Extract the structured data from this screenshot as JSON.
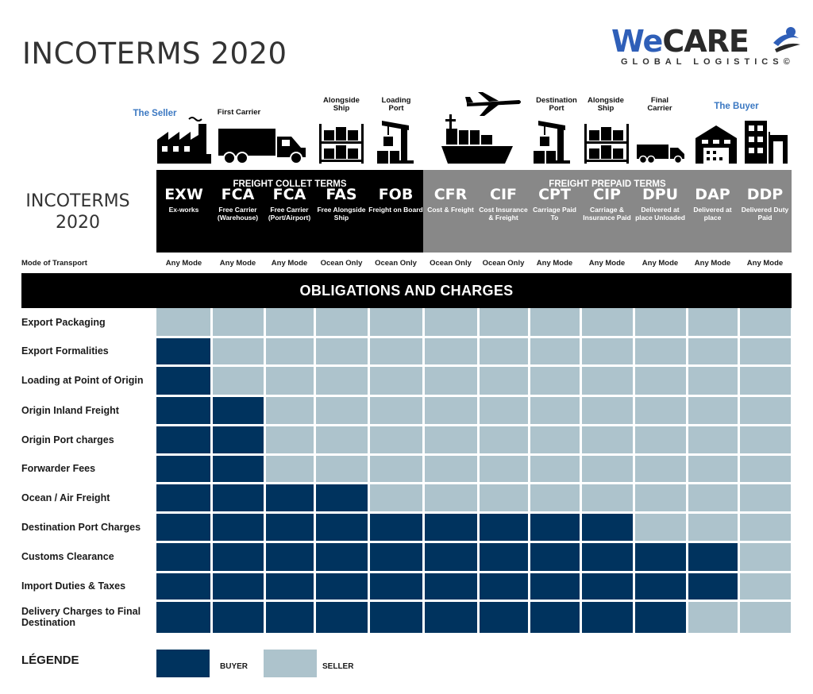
{
  "page": {
    "title": "INCOTERMS 2020",
    "left_title_line1": "INCOTERMS",
    "left_title_line2": "2020"
  },
  "logo": {
    "we": "We",
    "care": "CARE",
    "subtitle": "GLOBAL LOGISTICS©"
  },
  "colors": {
    "buyer": "#00335e",
    "seller": "#adc3cc",
    "collect_bg": "#000000",
    "prepaid_bg": "#888888",
    "accent_blue": "#3b78c2"
  },
  "stages": [
    {
      "label": "The Seller",
      "icon": "factory-icon",
      "highlight": true
    },
    {
      "label": "First Carrier",
      "icon": "truck-icon",
      "highlight": false
    },
    {
      "label": "Alongside Ship",
      "icon": "warehouse-shelf-icon",
      "highlight": false
    },
    {
      "label": "Loading Port",
      "icon": "crane-icon",
      "highlight": false
    },
    {
      "label": "",
      "icon": "airplane-icon",
      "highlight": false
    },
    {
      "label": "",
      "icon": "cargo-ship-icon",
      "highlight": false
    },
    {
      "label": "Destination Port",
      "icon": "crane-icon",
      "highlight": false
    },
    {
      "label": "Alongside Ship",
      "icon": "warehouse-shelf-icon",
      "highlight": false
    },
    {
      "label": "Final Carrier",
      "icon": "small-truck-icon",
      "highlight": false
    },
    {
      "label": "The Buyer",
      "icon": "warehouse-icon",
      "highlight": true
    },
    {
      "label": "",
      "icon": "office-building-icon",
      "highlight": false
    }
  ],
  "groups": {
    "collect": "FREIGHT COLLET TERMS",
    "prepaid": "FREIGHT PREPAID TERMS"
  },
  "mode_label": "Mode of Transport",
  "terms": [
    {
      "code": "EXW",
      "desc": "Ex-works",
      "mode": "Any Mode"
    },
    {
      "code": "FCA",
      "desc": "Free Carrier (Warehouse)",
      "mode": "Any Mode"
    },
    {
      "code": "FCA",
      "desc": "Free Carrier (Port/Airport)",
      "mode": "Any Mode"
    },
    {
      "code": "FAS",
      "desc": "Free Alongside Ship",
      "mode": "Ocean Only"
    },
    {
      "code": "FOB",
      "desc": "Freight on Board",
      "mode": "Ocean Only"
    },
    {
      "code": "CFR",
      "desc": "Cost & Freight",
      "mode": "Ocean Only"
    },
    {
      "code": "CIF",
      "desc": "Cost Insurance & Freight",
      "mode": "Ocean Only"
    },
    {
      "code": "CPT",
      "desc": "Carriage Paid To",
      "mode": "Any Mode"
    },
    {
      "code": "CIP",
      "desc": "Carriage & Insurance Paid",
      "mode": "Any Mode"
    },
    {
      "code": "DPU",
      "desc": "Delivered at place Unloaded",
      "mode": "Any Mode"
    },
    {
      "code": "DAP",
      "desc": "Delivered at place",
      "mode": "Any Mode"
    },
    {
      "code": "DDP",
      "desc": "Delivered Duty Paid",
      "mode": "Any Mode"
    }
  ],
  "banner": "OBLIGATIONS AND CHARGES",
  "obligations": [
    {
      "label": "Export Packaging",
      "buyer_count": 0
    },
    {
      "label": "Export Formalities",
      "buyer_count": 1
    },
    {
      "label": "Loading at Point of Origin",
      "buyer_count": 1
    },
    {
      "label": "Origin Inland Freight",
      "buyer_count": 2
    },
    {
      "label": "Origin Port charges",
      "buyer_count": 2
    },
    {
      "label": "Forwarder Fees",
      "buyer_count": 2
    },
    {
      "label": "Ocean / Air Freight",
      "buyer_count": 4
    },
    {
      "label": "Destination Port Charges",
      "buyer_count": 9
    },
    {
      "label": "Customs Clearance",
      "buyer_count": 11
    },
    {
      "label": "Import Duties & Taxes",
      "buyer_count": 11
    },
    {
      "label": "Delivery Charges to Final Destination",
      "buyer_count": 10
    }
  ],
  "legend": {
    "title": "LÉGENDE",
    "buyer": "BUYER",
    "seller": "SELLER"
  }
}
